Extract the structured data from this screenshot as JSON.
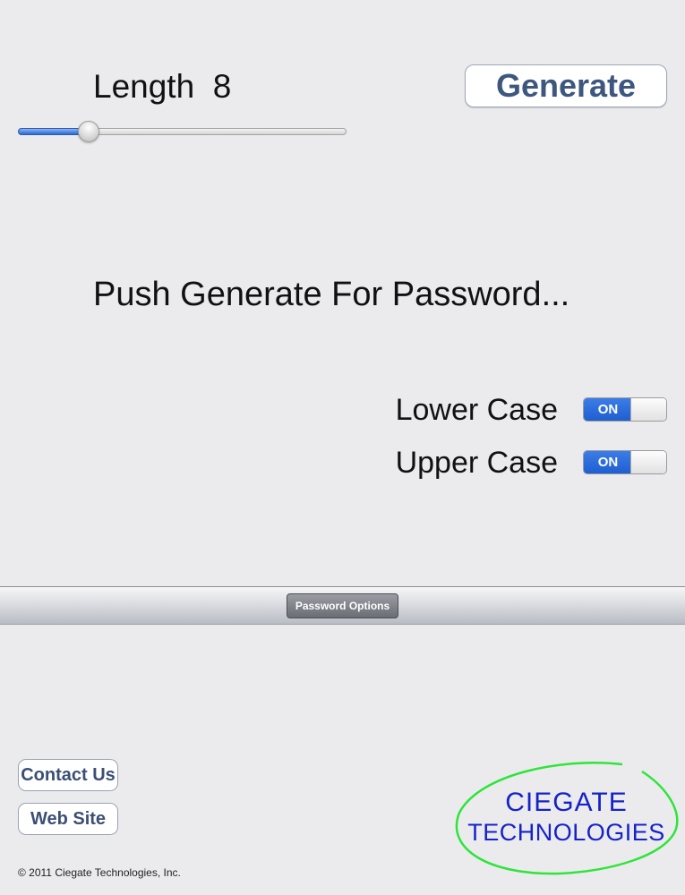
{
  "length": {
    "label": "Length",
    "value": "8",
    "slider_fraction": 0.196
  },
  "generate_button": "Generate",
  "password_output": "Push Generate For Password...",
  "toggles": {
    "lower_case": {
      "label": "Lower Case",
      "state": "ON"
    },
    "upper_case": {
      "label": "Upper Case",
      "state": "ON"
    }
  },
  "options_bar": {
    "button": "Password Options"
  },
  "links": {
    "contact_us": "Contact Us",
    "web_site": "Web Site"
  },
  "copyright": "© 2011 Ciegate Technologies, Inc.",
  "logo": {
    "line1": "CIEGATE",
    "line2": "TECHNOLOGIES"
  },
  "colors": {
    "accent_blue": "#2c6ad8",
    "button_text": "#3d577f",
    "logo_blue": "#1523c9",
    "logo_green": "#2ee53a"
  },
  "icons": {
    "slider_thumb": "slider-thumb"
  }
}
